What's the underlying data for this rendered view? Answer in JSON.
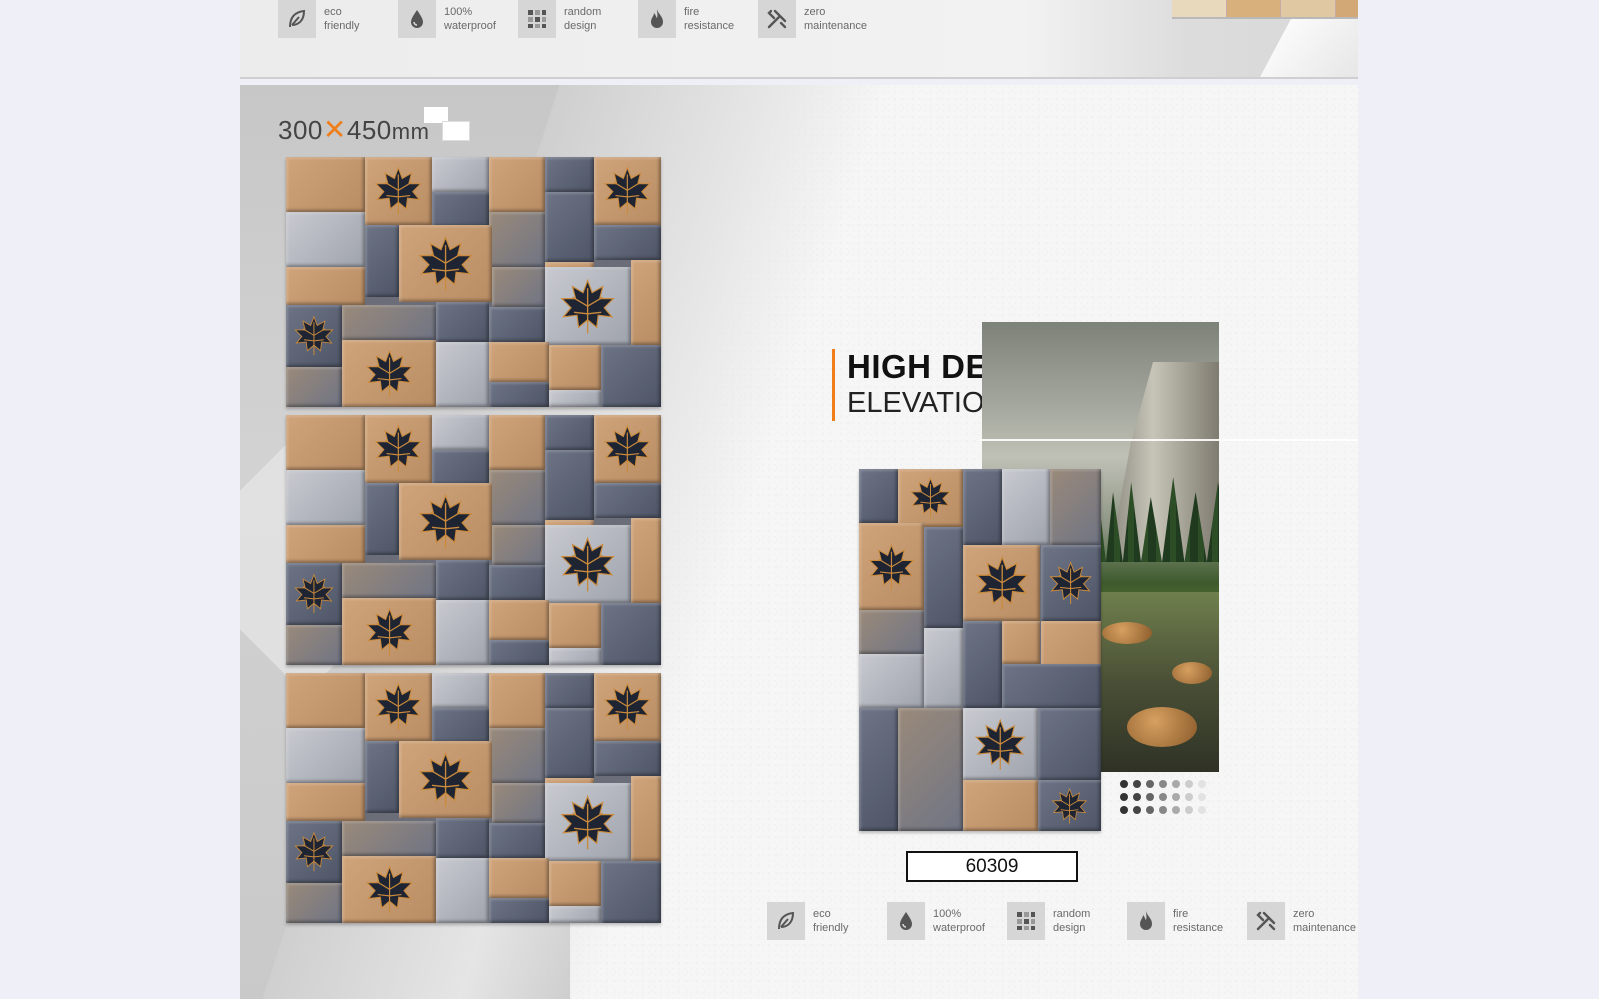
{
  "features": [
    {
      "icon": "leaf-icon",
      "label": "eco\nfriendly"
    },
    {
      "icon": "water-drop-icon",
      "label": "100%\nwaterproof"
    },
    {
      "icon": "grid-pattern-icon",
      "label": "random\ndesign"
    },
    {
      "icon": "flame-icon",
      "label": "fire\nresistance"
    },
    {
      "icon": "tools-icon",
      "label": "zero\nmaintenance"
    }
  ],
  "size": {
    "w": "300",
    "x": "✕",
    "h": "450",
    "unit": "mm"
  },
  "headline": {
    "line1": "HIGH DEPTH",
    "line2": "ELEVATION TILES"
  },
  "product_code": "60309",
  "colors": {
    "accent": "#f07e1a",
    "tan": "#c49a72",
    "slate": "#5f6676",
    "light": "#b9bcc4"
  }
}
